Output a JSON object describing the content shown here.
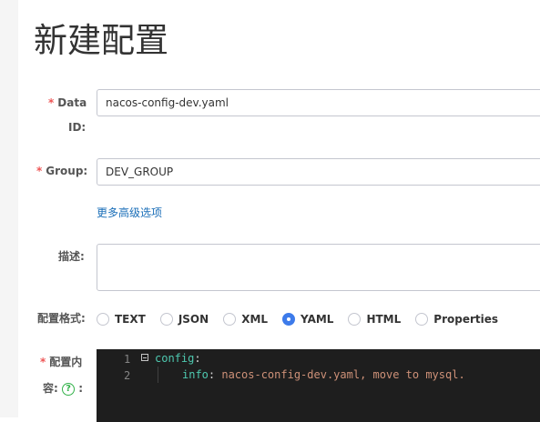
{
  "page": {
    "title": "新建配置"
  },
  "form": {
    "data_id": {
      "label_line1": "Data",
      "label_line2": "ID:",
      "value": "nacos-config-dev.yaml"
    },
    "group": {
      "label": "Group:",
      "value": "DEV_GROUP"
    },
    "advanced_link": "更多高级选项",
    "description": {
      "label": "描述:",
      "value": ""
    },
    "format": {
      "label": "配置格式:",
      "options": [
        "TEXT",
        "JSON",
        "XML",
        "YAML",
        "HTML",
        "Properties"
      ],
      "selected": "YAML"
    },
    "content": {
      "label_line1": "配置内",
      "label_line2": "容:",
      "help_icon": "question-circle-icon",
      "help_glyph": "?",
      "line_numbers": [
        "1",
        "2"
      ],
      "lines": [
        {
          "key": "config",
          "sep": ":",
          "value": ""
        },
        {
          "key": "info",
          "sep": ": ",
          "value": "nacos-config-dev.yaml, move to mysql."
        }
      ]
    },
    "required_mark": "*",
    "colon": ":"
  },
  "colors": {
    "accent": "#3d7bea",
    "link": "#1a6eb8",
    "required": "#e55",
    "editor_bg": "#1e1e1e",
    "yaml_key": "#4ec9b0",
    "yaml_value": "#ce9178"
  }
}
